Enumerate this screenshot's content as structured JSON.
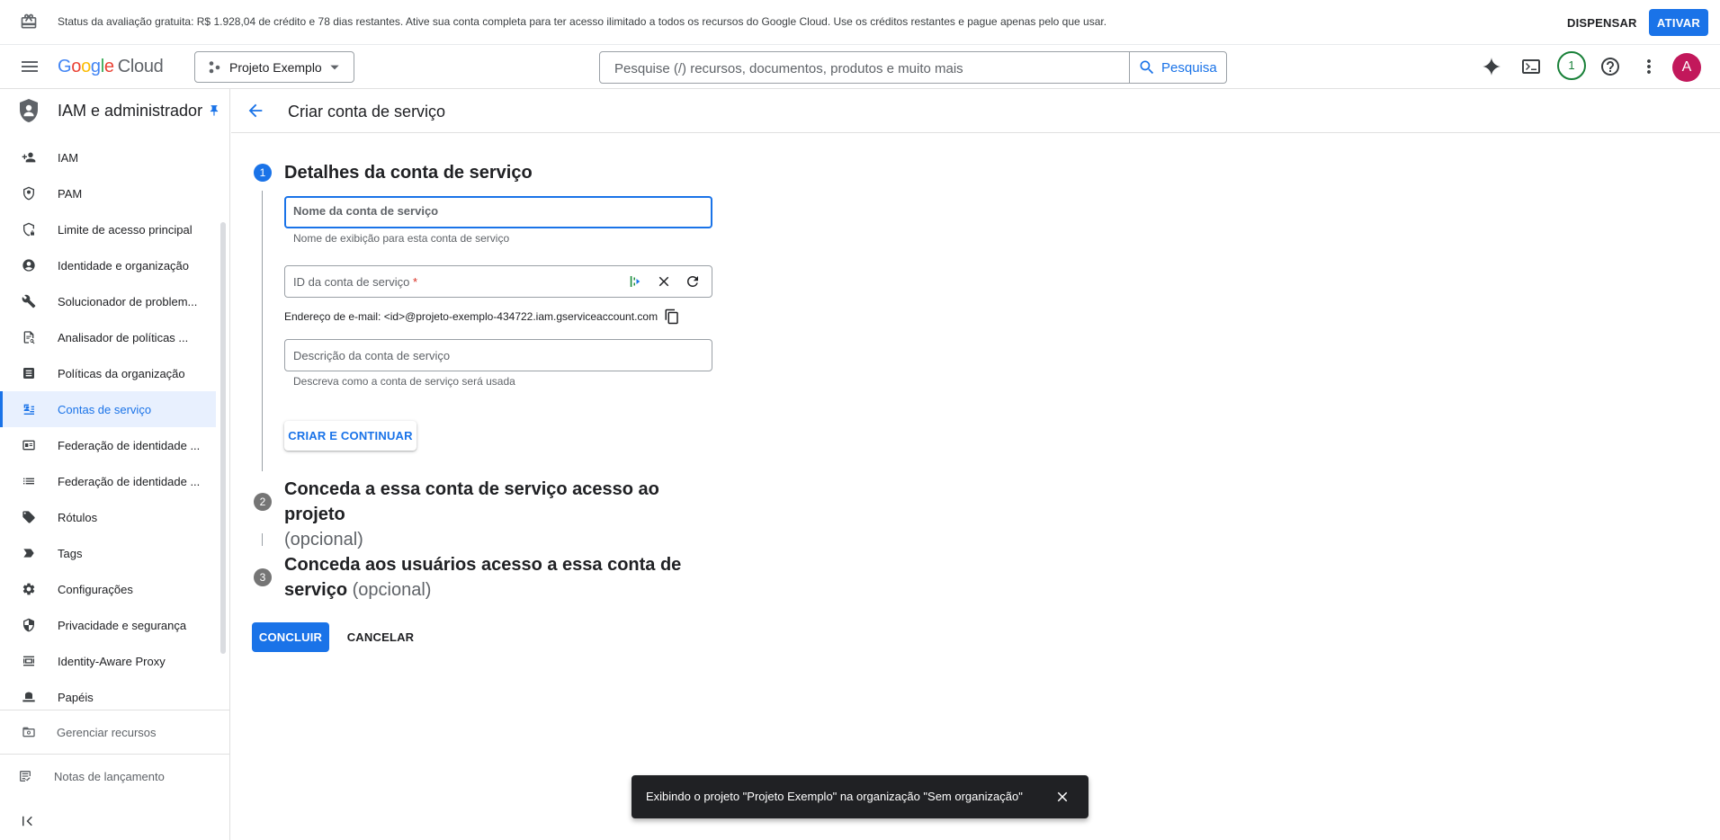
{
  "banner": {
    "text": "Status da avaliação gratuita: R$ 1.928,04 de crédito e 78 dias restantes. Ative sua conta completa para ter acesso ilimitado a todos os recursos do Google Cloud. Use os créditos restantes e pague apenas pelo que usar.",
    "dismiss_label": "DISPENSAR",
    "activate_label": "ATIVAR"
  },
  "header": {
    "logo_google": [
      "G",
      "o",
      "o",
      "g",
      "l",
      "e"
    ],
    "logo_cloud": "Cloud",
    "project_name": "Projeto Exemplo",
    "search_placeholder": "Pesquise (/) recursos, documentos, produtos e muito mais",
    "search_button": "Pesquisa",
    "notification_count": "1",
    "avatar_initial": "A"
  },
  "sidebar": {
    "section_title": "IAM e administrador",
    "items": [
      {
        "label": "IAM",
        "icon": "person-add-icon"
      },
      {
        "label": "PAM",
        "icon": "shield-icon"
      },
      {
        "label": "Limite de acesso principal",
        "icon": "shield-lock-icon"
      },
      {
        "label": "Identidade e organização",
        "icon": "account-circle-icon"
      },
      {
        "label": "Solucionador de problem...",
        "icon": "wrench-icon"
      },
      {
        "label": "Analisador de políticas ...",
        "icon": "policy-search-icon"
      },
      {
        "label": "Políticas da organização",
        "icon": "document-icon"
      },
      {
        "label": "Contas de serviço",
        "icon": "service-account-icon"
      },
      {
        "label": "Federação de identidade ...",
        "icon": "id-card-icon"
      },
      {
        "label": "Federação de identidade ...",
        "icon": "list-icon"
      },
      {
        "label": "Rótulos",
        "icon": "label-tag-icon"
      },
      {
        "label": "Tags",
        "icon": "tag-arrow-icon"
      },
      {
        "label": "Configurações",
        "icon": "gear-icon"
      },
      {
        "label": "Privacidade e segurança",
        "icon": "privacy-shield-icon"
      },
      {
        "label": "Identity-Aware Proxy",
        "icon": "proxy-icon"
      },
      {
        "label": "Papéis",
        "icon": "hat-icon"
      }
    ],
    "active_index": 7,
    "footer": [
      {
        "label": "Gerenciar recursos",
        "icon": "folder-gear-icon"
      },
      {
        "label": "Notas de lançamento",
        "icon": "release-notes-icon"
      }
    ]
  },
  "page": {
    "title": "Criar conta de serviço"
  },
  "stepper": {
    "step1": {
      "number": "1",
      "title": "Detalhes da conta de serviço",
      "name_label": "Nome da conta de serviço",
      "name_hint": "Nome de exibição para esta conta de serviço",
      "id_label": "ID da conta de serviço",
      "id_required": "*",
      "email_text": "Endereço de e-mail: <id>@projeto-exemplo-434722.iam.gserviceaccount.com",
      "description_label": "Descrição da conta de serviço",
      "description_hint": "Descreva como a conta de serviço será usada",
      "create_button": "CRIAR E CONTINUAR"
    },
    "step2": {
      "number": "2",
      "title": "Conceda a essa conta de serviço acesso ao projeto",
      "optional": "(opcional)"
    },
    "step3": {
      "number": "3",
      "title_line1": "Conceda aos usuários acesso a essa conta de",
      "title_line2": "serviço",
      "optional": "(opcional)"
    },
    "done_button": "CONCLUIR",
    "cancel_button": "CANCELAR"
  },
  "snackbar": {
    "text": "Exibindo o projeto \"Projeto Exemplo\" na organização \"Sem organização\""
  },
  "colors": {
    "accent": "#1a73e8",
    "active_bg": "#e8f0fe",
    "snackbar_bg": "#202124",
    "avatar_bg": "#c2185b",
    "badge": "#188038"
  }
}
